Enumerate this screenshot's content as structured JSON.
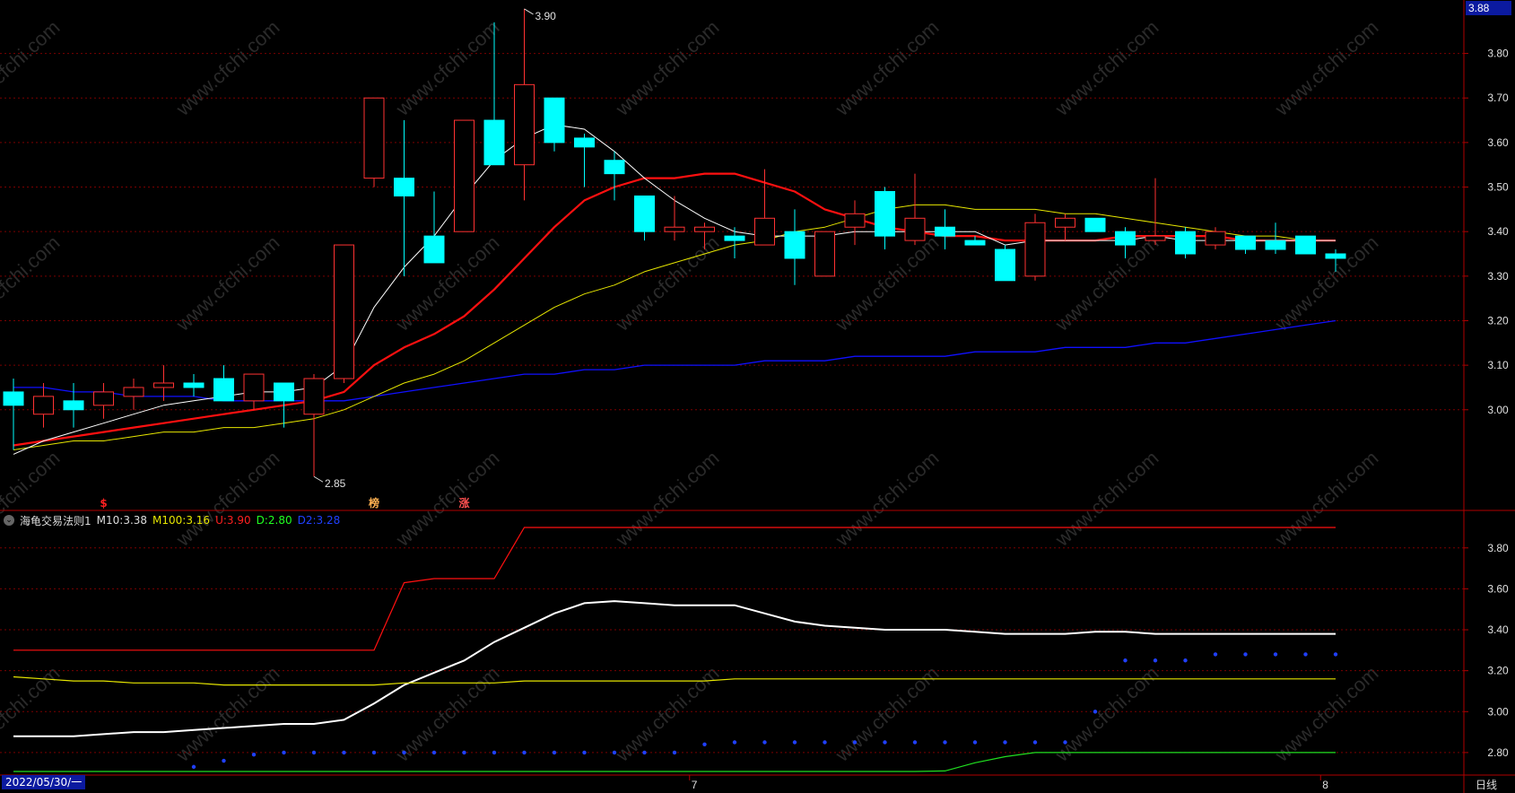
{
  "price_badge": "3.88",
  "period_label": "日线",
  "start_date": "2022/05/30/一",
  "bottom_marks": [
    {
      "label": "7",
      "idx": 23
    },
    {
      "label": "8",
      "idx": 44
    }
  ],
  "annotations": {
    "high": "3.90",
    "low": "2.85"
  },
  "signals": [
    {
      "text": "$",
      "idx": 3,
      "color": "#ff2020"
    },
    {
      "text": "榜",
      "idx": 12,
      "color": "#ffb050"
    },
    {
      "text": "涨",
      "idx": 15,
      "color": "#ff5050"
    }
  ],
  "indicator": {
    "name": "海龟交易法则1",
    "items": [
      {
        "label": "M10:",
        "value": "3.38",
        "color": "#ffffff"
      },
      {
        "label": "M100:",
        "value": "3.16",
        "color": "#ffff00"
      },
      {
        "label": "U:",
        "value": "3.90",
        "color": "#ff2020"
      },
      {
        "label": "D:",
        "value": "2.80",
        "color": "#20ff20"
      },
      {
        "label": "D2:",
        "value": "3.28",
        "color": "#2040ff"
      }
    ]
  },
  "watermark": "www.cfchi.com",
  "colors": {
    "up": "#ff3232",
    "down": "#00ffff",
    "ma_white": "#ffffff",
    "ma_red": "#ff1010",
    "ma_yellow": "#e6e600",
    "ma_blue": "#1010ff",
    "grid": "#7a0000",
    "axis": "#b00000"
  },
  "chart_data": [
    {
      "type": "candlestick",
      "ylim": [
        2.78,
        3.92
      ],
      "ticks": [
        3.0,
        3.1,
        3.2,
        3.3,
        3.4,
        3.5,
        3.6,
        3.7,
        3.8
      ],
      "candles": [
        {
          "o": 3.04,
          "h": 3.07,
          "l": 2.91,
          "c": 3.01
        },
        {
          "o": 2.99,
          "h": 3.06,
          "l": 2.96,
          "c": 3.03
        },
        {
          "o": 3.02,
          "h": 3.06,
          "l": 2.96,
          "c": 3.0
        },
        {
          "o": 3.01,
          "h": 3.06,
          "l": 2.98,
          "c": 3.04
        },
        {
          "o": 3.03,
          "h": 3.07,
          "l": 3.0,
          "c": 3.05
        },
        {
          "o": 3.05,
          "h": 3.1,
          "l": 3.02,
          "c": 3.06
        },
        {
          "o": 3.06,
          "h": 3.08,
          "l": 3.03,
          "c": 3.05
        },
        {
          "o": 3.07,
          "h": 3.1,
          "l": 3.02,
          "c": 3.02
        },
        {
          "o": 3.02,
          "h": 3.08,
          "l": 3.0,
          "c": 3.08
        },
        {
          "o": 3.06,
          "h": 3.06,
          "l": 2.96,
          "c": 3.02
        },
        {
          "o": 2.99,
          "h": 3.08,
          "l": 2.85,
          "c": 3.07
        },
        {
          "o": 3.07,
          "h": 3.37,
          "l": 3.06,
          "c": 3.37
        },
        {
          "o": 3.52,
          "h": 3.7,
          "l": 3.5,
          "c": 3.7
        },
        {
          "o": 3.52,
          "h": 3.65,
          "l": 3.3,
          "c": 3.48
        },
        {
          "o": 3.39,
          "h": 3.49,
          "l": 3.33,
          "c": 3.33
        },
        {
          "o": 3.4,
          "h": 3.65,
          "l": 3.4,
          "c": 3.65
        },
        {
          "o": 3.65,
          "h": 3.87,
          "l": 3.55,
          "c": 3.55
        },
        {
          "o": 3.55,
          "h": 3.9,
          "l": 3.47,
          "c": 3.73
        },
        {
          "o": 3.7,
          "h": 3.7,
          "l": 3.58,
          "c": 3.6
        },
        {
          "o": 3.61,
          "h": 3.62,
          "l": 3.5,
          "c": 3.59
        },
        {
          "o": 3.56,
          "h": 3.58,
          "l": 3.47,
          "c": 3.53
        },
        {
          "o": 3.48,
          "h": 3.48,
          "l": 3.38,
          "c": 3.4
        },
        {
          "o": 3.4,
          "h": 3.48,
          "l": 3.38,
          "c": 3.41
        },
        {
          "o": 3.4,
          "h": 3.42,
          "l": 3.36,
          "c": 3.41
        },
        {
          "o": 3.39,
          "h": 3.41,
          "l": 3.34,
          "c": 3.38
        },
        {
          "o": 3.37,
          "h": 3.54,
          "l": 3.37,
          "c": 3.43
        },
        {
          "o": 3.4,
          "h": 3.45,
          "l": 3.28,
          "c": 3.34
        },
        {
          "o": 3.3,
          "h": 3.4,
          "l": 3.3,
          "c": 3.4
        },
        {
          "o": 3.41,
          "h": 3.47,
          "l": 3.37,
          "c": 3.44
        },
        {
          "o": 3.49,
          "h": 3.5,
          "l": 3.36,
          "c": 3.39
        },
        {
          "o": 3.38,
          "h": 3.53,
          "l": 3.37,
          "c": 3.43
        },
        {
          "o": 3.41,
          "h": 3.45,
          "l": 3.36,
          "c": 3.39
        },
        {
          "o": 3.38,
          "h": 3.39,
          "l": 3.37,
          "c": 3.37
        },
        {
          "o": 3.36,
          "h": 3.37,
          "l": 3.29,
          "c": 3.29
        },
        {
          "o": 3.3,
          "h": 3.44,
          "l": 3.29,
          "c": 3.42
        },
        {
          "o": 3.41,
          "h": 3.44,
          "l": 3.38,
          "c": 3.43
        },
        {
          "o": 3.43,
          "h": 3.43,
          "l": 3.4,
          "c": 3.4
        },
        {
          "o": 3.4,
          "h": 3.41,
          "l": 3.34,
          "c": 3.37
        },
        {
          "o": 3.38,
          "h": 3.52,
          "l": 3.37,
          "c": 3.39
        },
        {
          "o": 3.4,
          "h": 3.41,
          "l": 3.34,
          "c": 3.35
        },
        {
          "o": 3.37,
          "h": 3.41,
          "l": 3.36,
          "c": 3.4
        },
        {
          "o": 3.39,
          "h": 3.39,
          "l": 3.35,
          "c": 3.36
        },
        {
          "o": 3.38,
          "h": 3.42,
          "l": 3.35,
          "c": 3.36
        },
        {
          "o": 3.39,
          "h": 3.39,
          "l": 3.35,
          "c": 3.35
        },
        {
          "o": 3.35,
          "h": 3.36,
          "l": 3.31,
          "c": 3.34
        }
      ],
      "ma_white": [
        2.9,
        2.93,
        2.95,
        2.97,
        2.99,
        3.01,
        3.02,
        3.03,
        3.04,
        3.04,
        3.05,
        3.1,
        3.23,
        3.32,
        3.39,
        3.48,
        3.56,
        3.61,
        3.64,
        3.63,
        3.58,
        3.52,
        3.47,
        3.43,
        3.4,
        3.39,
        3.39,
        3.39,
        3.4,
        3.4,
        3.4,
        3.4,
        3.4,
        3.37,
        3.38,
        3.38,
        3.38,
        3.38,
        3.39,
        3.38,
        3.38,
        3.38,
        3.38,
        3.38,
        3.38
      ],
      "ma_red": [
        2.92,
        2.93,
        2.94,
        2.95,
        2.96,
        2.97,
        2.98,
        2.99,
        3.0,
        3.01,
        3.02,
        3.04,
        3.1,
        3.14,
        3.17,
        3.21,
        3.27,
        3.34,
        3.41,
        3.47,
        3.5,
        3.52,
        3.52,
        3.53,
        3.53,
        3.51,
        3.49,
        3.45,
        3.43,
        3.41,
        3.4,
        3.39,
        3.39,
        3.38,
        3.38,
        3.38,
        3.38,
        3.39,
        3.39,
        3.39,
        3.39,
        3.38,
        3.38,
        3.38,
        3.38
      ],
      "ma_yellow": [
        2.91,
        2.92,
        2.93,
        2.93,
        2.94,
        2.95,
        2.95,
        2.96,
        2.96,
        2.97,
        2.98,
        3.0,
        3.03,
        3.06,
        3.08,
        3.11,
        3.15,
        3.19,
        3.23,
        3.26,
        3.28,
        3.31,
        3.33,
        3.35,
        3.37,
        3.38,
        3.4,
        3.41,
        3.43,
        3.45,
        3.46,
        3.46,
        3.45,
        3.45,
        3.45,
        3.44,
        3.44,
        3.43,
        3.42,
        3.41,
        3.4,
        3.39,
        3.39,
        3.38,
        3.38
      ],
      "ma_blue": [
        3.05,
        3.05,
        3.04,
        3.04,
        3.03,
        3.03,
        3.03,
        3.02,
        3.02,
        3.02,
        3.02,
        3.02,
        3.03,
        3.04,
        3.05,
        3.06,
        3.07,
        3.08,
        3.08,
        3.09,
        3.09,
        3.1,
        3.1,
        3.1,
        3.1,
        3.11,
        3.11,
        3.11,
        3.12,
        3.12,
        3.12,
        3.12,
        3.13,
        3.13,
        3.13,
        3.14,
        3.14,
        3.14,
        3.15,
        3.15,
        3.16,
        3.17,
        3.18,
        3.19,
        3.2
      ]
    },
    {
      "type": "line",
      "ylim": [
        2.69,
        3.97
      ],
      "ticks": [
        2.8,
        3.0,
        3.2,
        3.4,
        3.6,
        3.8
      ],
      "series": [
        {
          "name": "M10",
          "color": "#ffffff",
          "values": [
            2.88,
            2.88,
            2.88,
            2.89,
            2.9,
            2.9,
            2.91,
            2.92,
            2.93,
            2.94,
            2.94,
            2.96,
            3.04,
            3.13,
            3.19,
            3.25,
            3.34,
            3.41,
            3.48,
            3.53,
            3.54,
            3.53,
            3.52,
            3.52,
            3.52,
            3.48,
            3.44,
            3.42,
            3.41,
            3.4,
            3.4,
            3.4,
            3.39,
            3.38,
            3.38,
            3.38,
            3.39,
            3.39,
            3.38,
            3.38,
            3.38,
            3.38,
            3.38,
            3.38,
            3.38
          ]
        },
        {
          "name": "M100",
          "color": "#e6e600",
          "values": [
            3.17,
            3.16,
            3.15,
            3.15,
            3.14,
            3.14,
            3.14,
            3.13,
            3.13,
            3.13,
            3.13,
            3.13,
            3.13,
            3.14,
            3.14,
            3.14,
            3.14,
            3.15,
            3.15,
            3.15,
            3.15,
            3.15,
            3.15,
            3.15,
            3.16,
            3.16,
            3.16,
            3.16,
            3.16,
            3.16,
            3.16,
            3.16,
            3.16,
            3.16,
            3.16,
            3.16,
            3.16,
            3.16,
            3.16,
            3.16,
            3.16,
            3.16,
            3.16,
            3.16,
            3.16
          ]
        },
        {
          "name": "U",
          "color": "#ff1010",
          "values": [
            3.3,
            3.3,
            3.3,
            3.3,
            3.3,
            3.3,
            3.3,
            3.3,
            3.3,
            3.3,
            3.3,
            3.3,
            3.3,
            3.63,
            3.65,
            3.65,
            3.65,
            3.9,
            3.9,
            3.9,
            3.9,
            3.9,
            3.9,
            3.9,
            3.9,
            3.9,
            3.9,
            3.9,
            3.9,
            3.9,
            3.9,
            3.9,
            3.9,
            3.9,
            3.9,
            3.9,
            3.9,
            3.9,
            3.9,
            3.9,
            3.9,
            3.9,
            3.9,
            3.9,
            3.9
          ]
        },
        {
          "name": "D",
          "color": "#20e020",
          "values": [
            2.67,
            2.67,
            2.67,
            2.67,
            2.67,
            2.67,
            2.67,
            2.67,
            2.67,
            2.67,
            2.67,
            2.67,
            2.67,
            2.67,
            2.67,
            2.67,
            2.67,
            2.67,
            2.67,
            2.67,
            2.67,
            2.67,
            2.67,
            2.67,
            2.67,
            2.67,
            2.67,
            2.67,
            2.67,
            2.67,
            2.67,
            2.71,
            2.75,
            2.78,
            2.8,
            2.8,
            2.8,
            2.8,
            2.8,
            2.8,
            2.8,
            2.8,
            2.8,
            2.8,
            2.8
          ]
        },
        {
          "name": "D2",
          "color": "#2040ff",
          "style": "dots",
          "values": [
            2.67,
            2.67,
            2.67,
            2.67,
            2.67,
            2.68,
            2.73,
            2.76,
            2.79,
            2.8,
            2.8,
            2.8,
            2.8,
            2.8,
            2.8,
            2.8,
            2.8,
            2.8,
            2.8,
            2.8,
            2.8,
            2.8,
            2.8,
            2.84,
            2.85,
            2.85,
            2.85,
            2.85,
            2.85,
            2.85,
            2.85,
            2.85,
            2.85,
            2.85,
            2.85,
            2.85,
            3.0,
            3.25,
            3.25,
            3.25,
            3.28,
            3.28,
            3.28,
            3.28,
            3.28
          ]
        }
      ]
    }
  ]
}
